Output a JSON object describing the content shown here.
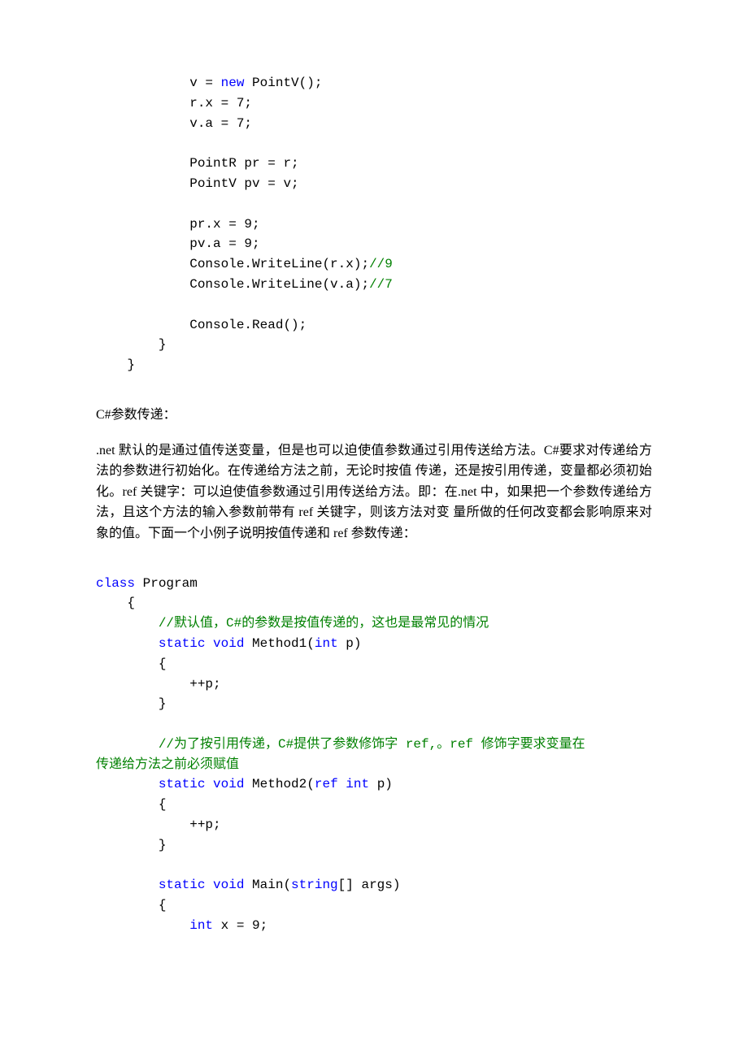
{
  "code1": [
    "            v = <kw>new</kw> PointV();",
    "            r.x = 7;",
    "            v.a = 7;",
    "",
    "            PointR pr = r;",
    "            PointV pv = v;",
    "",
    "            pr.x = 9;",
    "            pv.a = 9;",
    "            Console.WriteLine(r.x);<cm>//9</cm>",
    "            Console.WriteLine(v.a);<cm>//7</cm>",
    "",
    "            Console.Read();",
    "        }",
    "    }"
  ],
  "section_title": "C#参数传递：",
  "para": ".net 默认的是通过值传送变量，但是也可以迫使值参数通过引用传送给方法。C#要求对传递给方法的参数进行初始化。在传递给方法之前，无论时按值 传递，还是按引用传递，变量都必须初始化。ref 关键字：可以迫使值参数通过引用传送给方法。即：在.net 中，如果把一个参数传递给方法，且这个方法的输入参数前带有 ref 关键字，则该方法对变 量所做的任何改变都会影响原来对象的值。下面一个小例子说明按值传递和 ref 参数传递：",
  "code2": [
    "<kw>class</kw> Program",
    "    {",
    "        <cm>//默认值，C#的参数是按值传递的，这也是最常见的情况</cm>",
    "        <kw>static</kw> <kw>void</kw> Method1(<kw>int</kw> p)",
    "        {",
    "            ++p;",
    "        }",
    "",
    "        <cm>//为了按引用传递，C#提供了参数修饰字 ref,。ref 修饰字要求变量在</cm>",
    "<cm>传递给方法之前必须赋值</cm>",
    "        <kw>static</kw> <kw>void</kw> Method2(<kw>ref</kw> <kw>int</kw> p)",
    "        {",
    "            ++p;",
    "        }",
    "",
    "        <kw>static</kw> <kw>void</kw> Main(<kw>string</kw>[] args)",
    "        {",
    "            <kw>int</kw> x = 9;"
  ]
}
